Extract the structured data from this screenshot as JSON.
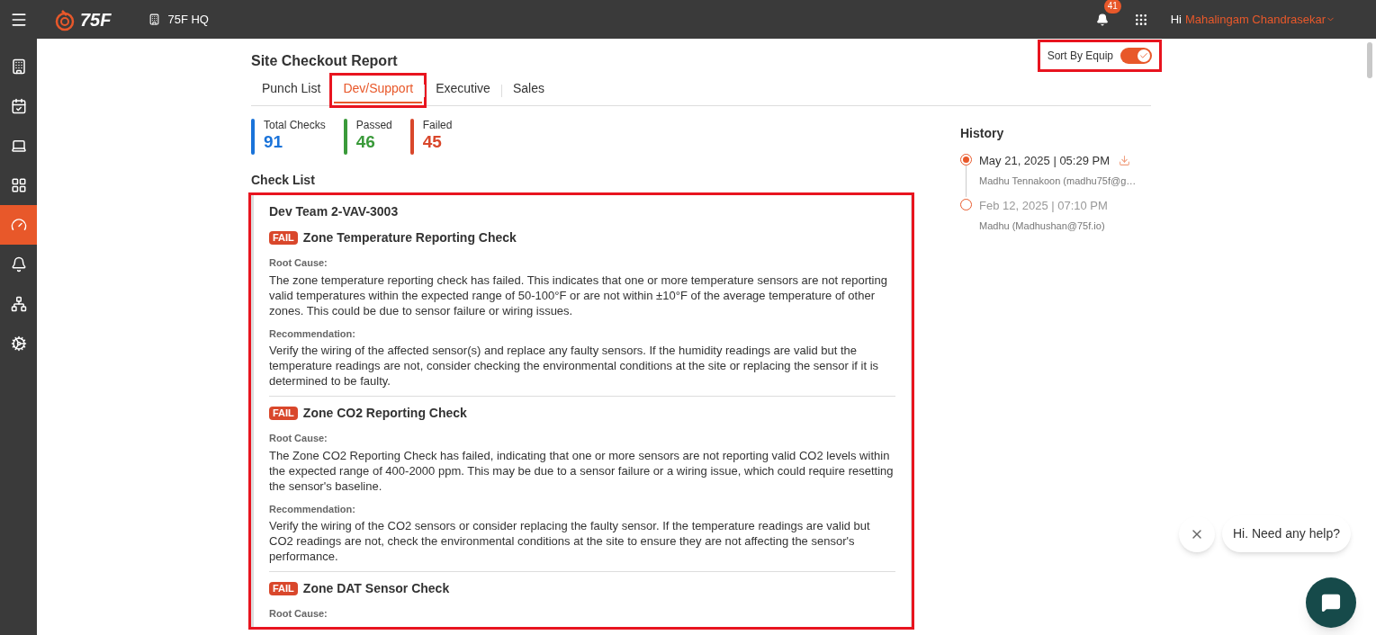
{
  "top_bar": {
    "logo_text": "75F",
    "site": "75F HQ",
    "notification_count": "41",
    "greeting": "Hi",
    "user_name": "Mahalingam Chandrasekar"
  },
  "sidebar": {
    "items": [
      {
        "selected": false
      },
      {
        "selected": false
      },
      {
        "selected": false
      },
      {
        "selected": false
      },
      {
        "selected": true
      },
      {
        "selected": false
      },
      {
        "selected": false
      },
      {
        "selected": false
      }
    ]
  },
  "report": {
    "title": "Site Checkout Report",
    "sort_toggle": {
      "label": "Sort By Equip",
      "on": true,
      "highlighted": true
    },
    "tabs": [
      {
        "label": "Punch List",
        "selected": false,
        "highlighted": false
      },
      {
        "label": "Dev/Support",
        "selected": true,
        "highlighted": true
      },
      {
        "label": "Executive",
        "selected": false,
        "highlighted": false
      },
      {
        "label": "Sales",
        "selected": false,
        "highlighted": false
      }
    ],
    "stats": [
      {
        "label": "Total Checks",
        "value": "91",
        "color": "#1a73d9"
      },
      {
        "label": "Passed",
        "value": "46",
        "color": "#3a9a3a"
      },
      {
        "label": "Failed",
        "value": "45",
        "color": "#d9472b"
      }
    ],
    "check_list": {
      "title": "Check List",
      "highlighted": true,
      "equipment": "Dev Team 2-VAV-3003",
      "checks": [
        {
          "status": "FAIL",
          "name": "Zone Temperature Reporting Check",
          "root_cause_label": "Root Cause:",
          "root_cause": "The zone temperature reporting check has failed. This indicates that one or more temperature sensors are not reporting valid temperatures within the expected range of 50-100°F or are not within ±10°F of the average temperature of other zones. This could be due to sensor failure or wiring issues.",
          "recommendation_label": "Recommendation:",
          "recommendation": "Verify the wiring of the affected sensor(s) and replace any faulty sensors. If the humidity readings are valid but the temperature readings are not, consider checking the environmental conditions at the site or replacing the sensor if it is determined to be faulty."
        },
        {
          "status": "FAIL",
          "name": "Zone CO2 Reporting Check",
          "root_cause_label": "Root Cause:",
          "root_cause": "The Zone CO2 Reporting Check has failed, indicating that one or more sensors are not reporting valid CO2 levels within the expected range of 400-2000 ppm. This may be due to a sensor failure or a wiring issue, which could require resetting the sensor's baseline.",
          "recommendation_label": "Recommendation:",
          "recommendation": "Verify the wiring of the CO2 sensors or consider replacing the faulty sensor. If the temperature readings are valid but CO2 readings are not, check the environmental conditions at the site to ensure they are not affecting the sensor's performance."
        },
        {
          "status": "FAIL",
          "name": "Zone DAT Sensor Check",
          "root_cause_label": "Root Cause:"
        }
      ]
    }
  },
  "history": {
    "title": "History",
    "entries": [
      {
        "date": "May 21, 2025 | 05:29 PM",
        "user": "Madhu Tennakoon (madhu75f@g…",
        "selected": true,
        "download": true
      },
      {
        "date": "Feb 12, 2025 | 07:10 PM",
        "user": "Madhu (Madhushan@75f.io)",
        "selected": false,
        "download": false
      }
    ]
  },
  "chat": {
    "message": "Hi. Need any help?"
  }
}
